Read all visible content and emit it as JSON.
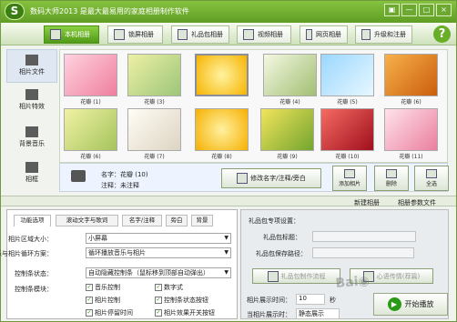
{
  "app": {
    "title": "数码大师2013  是最大最易用的家庭相册制作软件",
    "logo": "S",
    "help": "?"
  },
  "window": {
    "buttons": [
      "▣",
      "—",
      "□",
      "×"
    ]
  },
  "tabs": [
    {
      "label": "本机相册",
      "active": true
    },
    {
      "label": "锁屏相册"
    },
    {
      "label": "礼品包相册"
    },
    {
      "label": "视频相册"
    },
    {
      "label": "网页相册"
    },
    {
      "label": "升级和注册"
    }
  ],
  "sidebar": [
    {
      "label": "相片文件",
      "active": true
    },
    {
      "label": "相片特效"
    },
    {
      "label": "背景音乐"
    },
    {
      "label": "相框"
    }
  ],
  "gallery": {
    "thumbs": [
      {
        "caption": "花瓣 (1)",
        "color": "#f4a6bd"
      },
      {
        "caption": "花瓣 (3)",
        "color": "#b8cf8d"
      },
      {
        "caption": "",
        "color": "#f7c51d",
        "selected": true
      },
      {
        "caption": "花瓣 (4)",
        "color": "#d5e3b6"
      },
      {
        "caption": "花瓣 (5)",
        "color": "#bfe9ff"
      },
      {
        "caption": "花瓣 (6)",
        "color": "#ee8e24"
      },
      {
        "caption": "花瓣 (6)",
        "color": "#d6da7d"
      },
      {
        "caption": "花瓣 (7)",
        "color": "#f6f2e9"
      },
      {
        "caption": "花瓣 (8)",
        "color": "#ffd04a"
      },
      {
        "caption": "花瓣 (9)",
        "color": "#c1d25a"
      },
      {
        "caption": "花瓣 (10)",
        "color": "#da393e"
      },
      {
        "caption": "花瓣 (11)",
        "color": "#f3bfcd"
      }
    ]
  },
  "info": {
    "name": "名字：花瓣 (10)",
    "note": "注释：未注释"
  },
  "buttons": {
    "edit": "修改名字/注释/旁白",
    "add": "添加相片",
    "delete": "删除",
    "select_all": "全选",
    "new_album": "新建相册",
    "album_params": "相册参数文件"
  },
  "panel": {
    "tabs": [
      "功能选项",
      "滚动文字与歌词",
      "名字/注释",
      "旁白",
      "背景"
    ],
    "rows": [
      {
        "label": "相片区域大小：",
        "value": "小屏幕"
      },
      {
        "label": "音乐与相片循环方案：",
        "value": "循环播放音乐与相片"
      },
      {
        "label": "控制条状态：",
        "value": "自动隐藏控制条（鼠标移到顶部自动弹出）"
      }
    ],
    "module_label": "控制条模块：",
    "checks": [
      {
        "label": "音乐控制",
        "checked": true
      },
      {
        "label": "数字式",
        "checked": true
      },
      {
        "label": "相片控制",
        "checked": true
      },
      {
        "label": "控制条状态按钮",
        "checked": true
      },
      {
        "label": "相片停留时间",
        "checked": true
      },
      {
        "label": "相片效果开关按钮",
        "checked": true
      }
    ]
  },
  "gift": {
    "title": "礼品包专项设置：",
    "name_label": "礼品包标题：",
    "path_label": "礼品包保存路径：",
    "btn1": "礼品包制作流程",
    "btn2": "心语传情(荐篇)",
    "time_label": "相片展示时间：",
    "time": "10",
    "unit": "秒",
    "mode_label": "当相片展示时：",
    "mode": "静态展示"
  },
  "start": {
    "label": "开始播放"
  }
}
